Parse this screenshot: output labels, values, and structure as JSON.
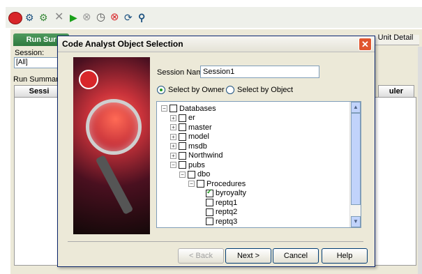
{
  "app": {
    "tab_label": "Run Sur",
    "unit_detail": "Unit Detail",
    "session_label": "Session:",
    "session_value": "[All]",
    "run_summary": "Run Summary",
    "col_session": "Sessi",
    "col_scheduler": "uler"
  },
  "dialog": {
    "title": "Code Analyst Object Selection",
    "session_name_label": "Session Name",
    "session_name_value": "Session1",
    "radio_owner": "Select by Owner",
    "radio_object": "Select by Object",
    "selected_radio": "owner",
    "tree": [
      {
        "label": "Databases",
        "level": 0,
        "expander": "minus",
        "checked": false
      },
      {
        "label": "er",
        "level": 1,
        "expander": "plus",
        "checked": false
      },
      {
        "label": "master",
        "level": 1,
        "expander": "plus",
        "checked": false
      },
      {
        "label": "model",
        "level": 1,
        "expander": "plus",
        "checked": false
      },
      {
        "label": "msdb",
        "level": 1,
        "expander": "plus",
        "checked": false
      },
      {
        "label": "Northwind",
        "level": 1,
        "expander": "plus",
        "checked": false
      },
      {
        "label": "pubs",
        "level": 1,
        "expander": "minus",
        "checked": false
      },
      {
        "label": "dbo",
        "level": 2,
        "expander": "minus",
        "checked": false
      },
      {
        "label": "Procedures",
        "level": 3,
        "expander": "minus",
        "checked": false
      },
      {
        "label": "byroyalty",
        "level": 4,
        "expander": "none",
        "checked": true
      },
      {
        "label": "reptq1",
        "level": 4,
        "expander": "none",
        "checked": false
      },
      {
        "label": "reptq2",
        "level": 4,
        "expander": "none",
        "checked": false
      },
      {
        "label": "reptq3",
        "level": 4,
        "expander": "none",
        "checked": false
      }
    ],
    "buttons": {
      "back": "< Back",
      "next": "Next >",
      "cancel": "Cancel",
      "help": "Help"
    }
  },
  "icons": [
    "database-icon",
    "analyze-icon",
    "compare-icon",
    "delete-icon",
    "play-icon",
    "stop-icon",
    "clock-icon",
    "cancel-icon",
    "refresh-icon",
    "users-icon"
  ],
  "colors": {
    "accent": "#2f7a3f",
    "title_close": "#e0552e",
    "tree_border": "#7f9db9"
  }
}
